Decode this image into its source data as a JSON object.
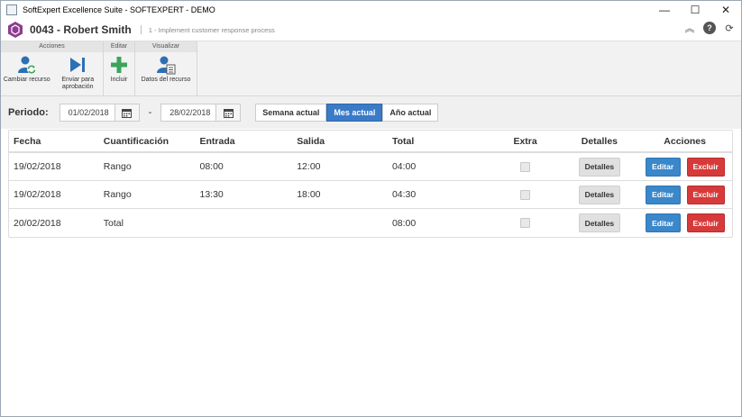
{
  "window": {
    "title": "SoftExpert Excellence Suite - SOFTEXPERT - DEMO",
    "controls": {
      "minimize": "—",
      "maximize": "☐",
      "close": "✕"
    }
  },
  "header": {
    "record_title": "0043 - Robert Smith",
    "subtitle": "1 - Implement customer response process",
    "icons": [
      "collapse-icon",
      "help-icon",
      "refresh-icon"
    ]
  },
  "ribbon": {
    "groups": [
      {
        "label": "Acciones",
        "buttons": [
          {
            "label": "Cambiar recurso",
            "icon": "change-resource-icon"
          },
          {
            "label": "Enviar para aprobación",
            "icon": "send-approval-icon"
          }
        ]
      },
      {
        "label": "Editar",
        "buttons": [
          {
            "label": "Incluir",
            "icon": "plus-icon"
          }
        ]
      },
      {
        "label": "Visualizar",
        "buttons": [
          {
            "label": "Datos del recurso",
            "icon": "resource-data-icon"
          }
        ]
      }
    ]
  },
  "filter": {
    "label": "Periodo:",
    "date_from": "01/02/2018",
    "date_to": "28/02/2018",
    "dash": "-",
    "periods": [
      "Semana actual",
      "Mes actual",
      "Año actual"
    ],
    "active_period": "Mes actual"
  },
  "table": {
    "headers": [
      "Fecha",
      "Cuantificación",
      "Entrada",
      "Salida",
      "Total",
      "Extra",
      "Detalles",
      "Acciones"
    ],
    "rows": [
      {
        "fecha": "19/02/2018",
        "cuantificacion": "Rango",
        "entrada": "08:00",
        "salida": "12:00",
        "total": "04:00",
        "extra": false
      },
      {
        "fecha": "19/02/2018",
        "cuantificacion": "Rango",
        "entrada": "13:30",
        "salida": "18:00",
        "total": "04:30",
        "extra": false
      },
      {
        "fecha": "20/02/2018",
        "cuantificacion": "Total",
        "entrada": "",
        "salida": "",
        "total": "08:00",
        "extra": false
      }
    ],
    "details_label": "Detalles",
    "edit_label": "Editar",
    "delete_label": "Excluir"
  },
  "colors": {
    "primary": "#3a7bc8",
    "danger": "#d63a3a",
    "add_green": "#3aa55a",
    "brand_purple": "#8e3c8e"
  }
}
